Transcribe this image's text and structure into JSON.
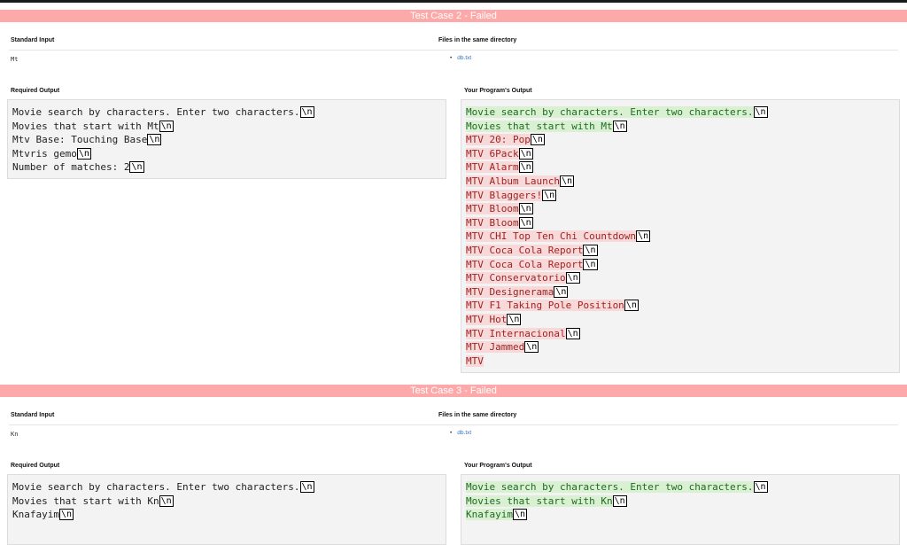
{
  "cases": [
    {
      "header": "Test Case 2 - Failed",
      "stdin_label": "Standard Input",
      "stdin_value": "Mt",
      "files_label": "Files in the same directory",
      "files": [
        "db.txt"
      ],
      "required_label": "Required Output",
      "required_lines": [
        "Movie search by characters. Enter two characters.",
        "Movies that start with Mt",
        "Mtv Base: Touching Base",
        "Mtvris gemo",
        "Number of matches: 2"
      ],
      "your_label": "Your Program's Output",
      "your_lines": [
        {
          "text": "Movie search by characters. Enter two characters.",
          "status": "ok",
          "nl": true
        },
        {
          "text": "Movies that start with Mt",
          "status": "ok",
          "nl": true
        },
        {
          "text": "MTV 20: Pop",
          "status": "bad",
          "nl": true
        },
        {
          "text": "MTV 6Pack",
          "status": "bad",
          "nl": true
        },
        {
          "text": "MTV Alarm",
          "status": "bad",
          "nl": true
        },
        {
          "text": "MTV Album Launch",
          "status": "bad",
          "nl": true
        },
        {
          "text": "MTV Blaggers!",
          "status": "bad",
          "nl": true
        },
        {
          "text": "MTV Bloom",
          "status": "bad",
          "nl": true
        },
        {
          "text": "MTV Bloom",
          "status": "bad",
          "nl": true
        },
        {
          "text": "MTV CHI Top Ten Chi Countdown",
          "status": "bad",
          "nl": true
        },
        {
          "text": "MTV Coca Cola Report",
          "status": "bad",
          "nl": true
        },
        {
          "text": "MTV Coca Cola Report",
          "status": "bad",
          "nl": true
        },
        {
          "text": "MTV Conservatorio",
          "status": "bad",
          "nl": true
        },
        {
          "text": "MTV Designerama",
          "status": "bad",
          "nl": true
        },
        {
          "text": "MTV F1 Taking Pole Position",
          "status": "bad",
          "nl": true
        },
        {
          "text": "MTV Hot",
          "status": "bad",
          "nl": true
        },
        {
          "text": "MTV Internacional",
          "status": "bad",
          "nl": true
        },
        {
          "text": "MTV Jammed",
          "status": "bad",
          "nl": true
        },
        {
          "text": "MTV",
          "status": "bad",
          "nl": false
        }
      ]
    },
    {
      "header": "Test Case 3 - Failed",
      "stdin_label": "Standard Input",
      "stdin_value": "Kn",
      "files_label": "Files in the same directory",
      "files": [
        "db.txt"
      ],
      "required_label": "Required Output",
      "required_lines": [
        "Movie search by characters. Enter two characters.",
        "Movies that start with Kn",
        "Knafayim"
      ],
      "your_label": "Your Program's Output",
      "your_lines": [
        {
          "text": "Movie search by characters. Enter two characters.",
          "status": "ok",
          "nl": true
        },
        {
          "text": "Movies that start with Kn",
          "status": "ok",
          "nl": true
        },
        {
          "text": "Knafayim",
          "status": "ok",
          "nl": true
        }
      ]
    }
  ],
  "newline_marker": "\\n"
}
